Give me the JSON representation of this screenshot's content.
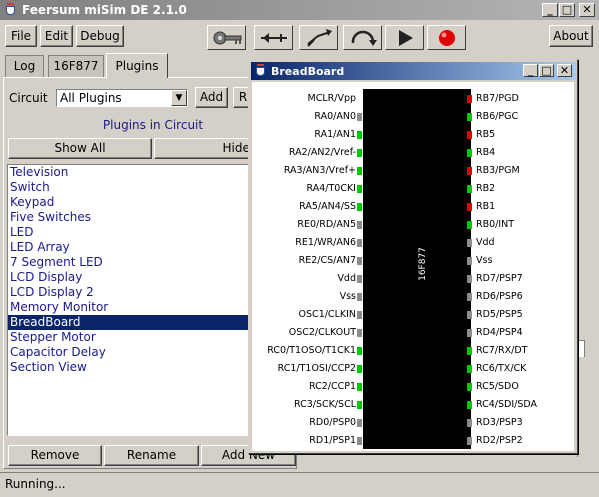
{
  "app": {
    "title": "Feersum miSim DE 2.1.0"
  },
  "menu": {
    "file": "File",
    "edit": "Edit",
    "debug": "Debug",
    "about": "About"
  },
  "toolbar_icons": [
    "key-icon",
    "step-back-icon",
    "step-over-icon",
    "rotate-icon",
    "play-icon",
    "record-icon"
  ],
  "tabs": {
    "log": "Log",
    "device": "16F877",
    "plugins": "Plugins"
  },
  "plugins_panel": {
    "circuit_label": "Circuit",
    "circuit_value": "All Plugins",
    "add_label": "Add",
    "rename_short": "R",
    "section_title": "Plugins in Circuit",
    "show_all": "Show All",
    "hide_all": "Hide All",
    "items": [
      "Television",
      "Switch",
      "Keypad",
      "Five Switches",
      "LED",
      "LED Array",
      "7 Segment LED",
      "LCD Display",
      "LCD Display 2",
      "Memory Monitor",
      "BreadBoard",
      "Stepper Motor",
      "Capacitor Delay",
      "Section View"
    ],
    "selected": "BreadBoard",
    "remove": "Remove",
    "rename": "Rename",
    "add_new": "Add New"
  },
  "breadboard": {
    "title": "BreadBoard",
    "chip_label": "16F877",
    "left_pins": [
      "MCLR/Vpp",
      "RA0/AN0",
      "RA1/AN1",
      "RA2/AN2/Vref-",
      "RA3/AN3/Vref+",
      "RA4/T0CKI",
      "RA5/AN4/SS",
      "RE0/RD/AN5",
      "RE1/WR/AN6",
      "RE2/CS/AN7",
      "Vdd",
      "Vss",
      "OSC1/CLKIN",
      "OSC2/CLKOUT",
      "RC0/T1OSO/T1CK1",
      "RC1/T1OSI/CCP2",
      "RC2/CCP1",
      "RC3/SCK/SCL",
      "RD0/PSP0",
      "RD1/PSP1"
    ],
    "left_states": [
      "none",
      "gray",
      "green",
      "green",
      "green",
      "green",
      "green",
      "gray",
      "gray",
      "gray",
      "gray",
      "gray",
      "gray",
      "gray",
      "green",
      "green",
      "green",
      "green",
      "gray",
      "gray"
    ],
    "right_pins": [
      "RB7/PGD",
      "RB6/PGC",
      "RB5",
      "RB4",
      "RB3/PGM",
      "RB2",
      "RB1",
      "RB0/INT",
      "Vdd",
      "Vss",
      "RD7/PSP7",
      "RD6/PSP6",
      "RD5/PSP5",
      "RD4/PSP4",
      "RC7/RX/DT",
      "RC6/TX/CK",
      "RC5/SDO",
      "RC4/SDI/SDA",
      "RD3/PSP3",
      "RD2/PSP2"
    ],
    "right_states": [
      "red",
      "green",
      "red",
      "green",
      "red",
      "green",
      "red",
      "green",
      "gray",
      "gray",
      "gray",
      "gray",
      "gray",
      "gray",
      "green",
      "green",
      "green",
      "green",
      "gray",
      "gray"
    ]
  },
  "status": {
    "text": "Running..."
  },
  "colors": {
    "pin_green": "#00c800",
    "pin_red": "#e00000",
    "pin_gray": "#8c8c8c",
    "selection": "#0a246a",
    "titlebar_active": "#0a246a"
  }
}
